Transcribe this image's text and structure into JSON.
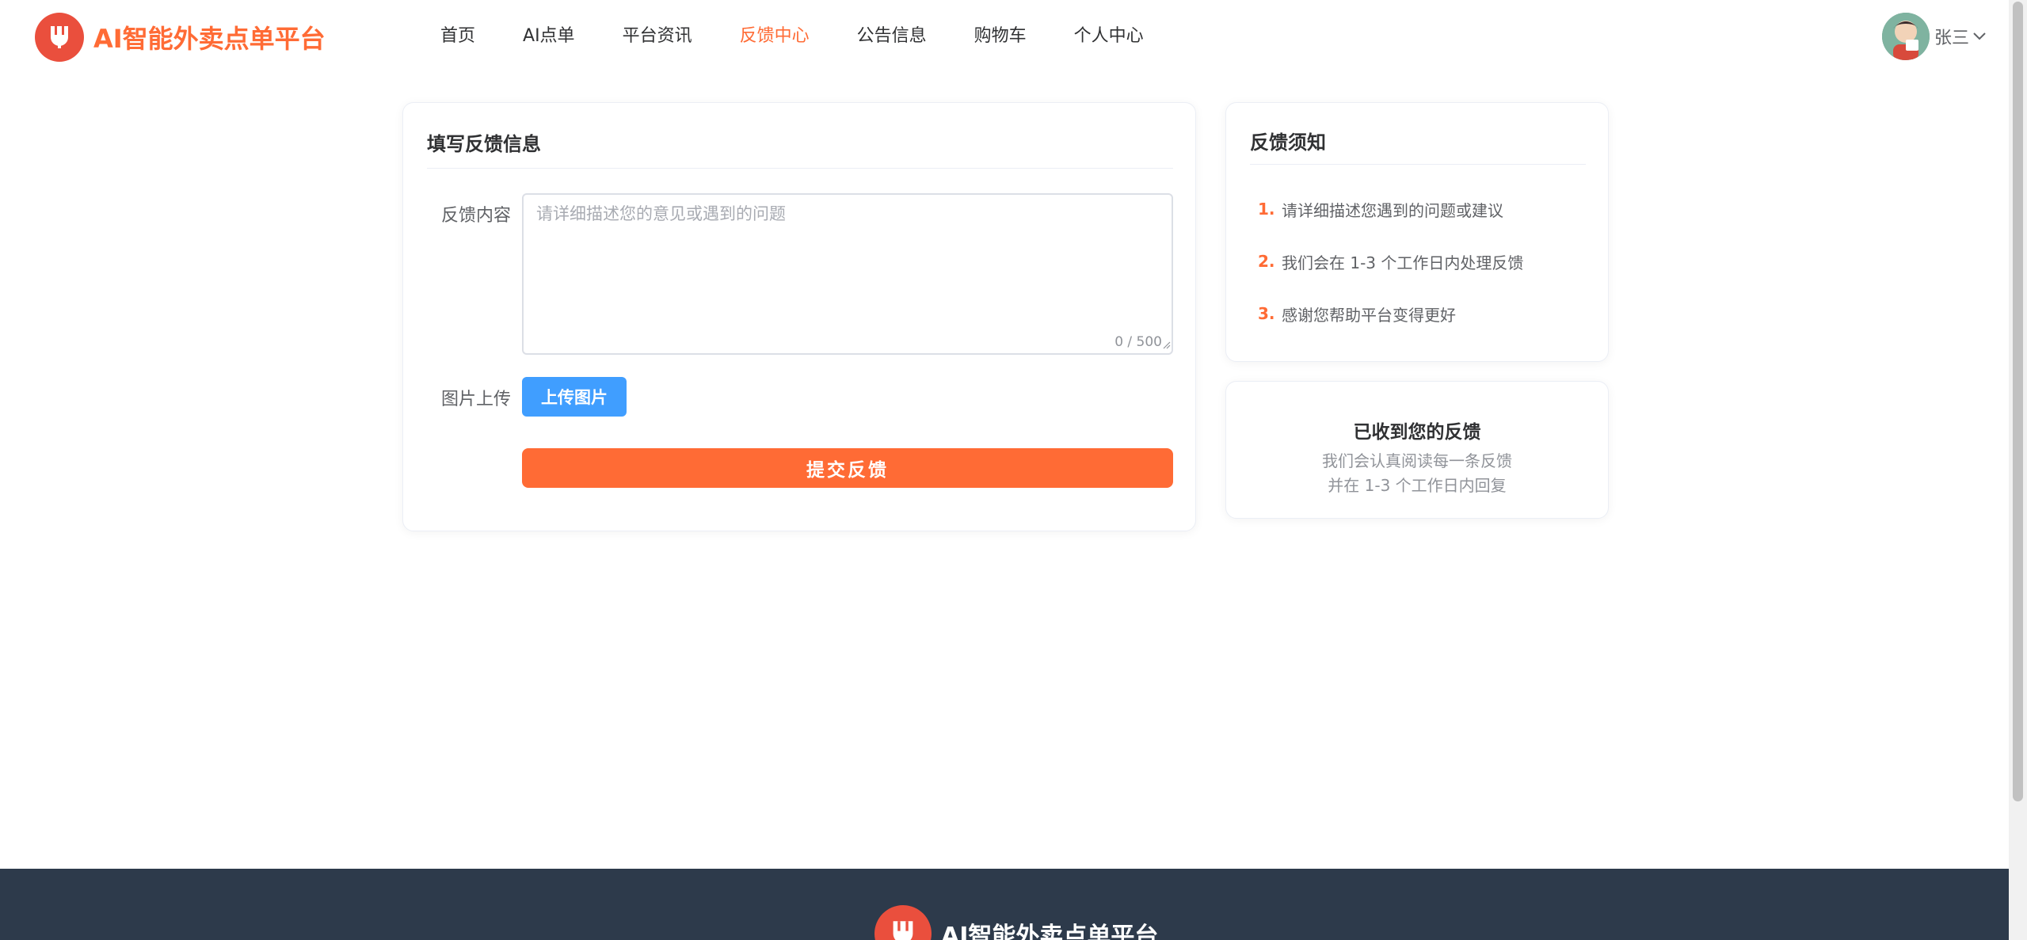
{
  "brand": {
    "name": "AI智能外卖点单平台",
    "color": "#ff6b35",
    "logo_icon": "fork-icon"
  },
  "nav": {
    "items": [
      {
        "label": "首页"
      },
      {
        "label": "AI点单"
      },
      {
        "label": "平台资讯"
      },
      {
        "label": "反馈中心",
        "active": true
      },
      {
        "label": "公告信息"
      },
      {
        "label": "购物车"
      },
      {
        "label": "个人中心"
      }
    ]
  },
  "user": {
    "name": "张三"
  },
  "form": {
    "title": "填写反馈信息",
    "content_label": "反馈内容",
    "content_placeholder": "请详细描述您的意见或遇到的问题",
    "content_counter": "0 / 500",
    "image_label": "图片上传",
    "upload_button": "上传图片",
    "submit_button": "提交反馈"
  },
  "notice": {
    "title": "反馈须知",
    "items": [
      {
        "num": "1.",
        "text": "请详细描述您遇到的问题或建议"
      },
      {
        "num": "2.",
        "text": "我们会在 1-3 个工作日内处理反馈"
      },
      {
        "num": "3.",
        "text": "感谢您帮助平台变得更好"
      }
    ]
  },
  "received": {
    "title": "已收到您的反馈",
    "line1": "我们会认真阅读每一条反馈",
    "line2": "并在 1-3 个工作日内回复"
  },
  "footer": {
    "brand": "AI智能外卖点单平台"
  },
  "colors": {
    "accent": "#ff6b35",
    "upload": "#409eff",
    "footer_bg": "#2d3a4b",
    "logo_bg": "#ea4f3d"
  }
}
